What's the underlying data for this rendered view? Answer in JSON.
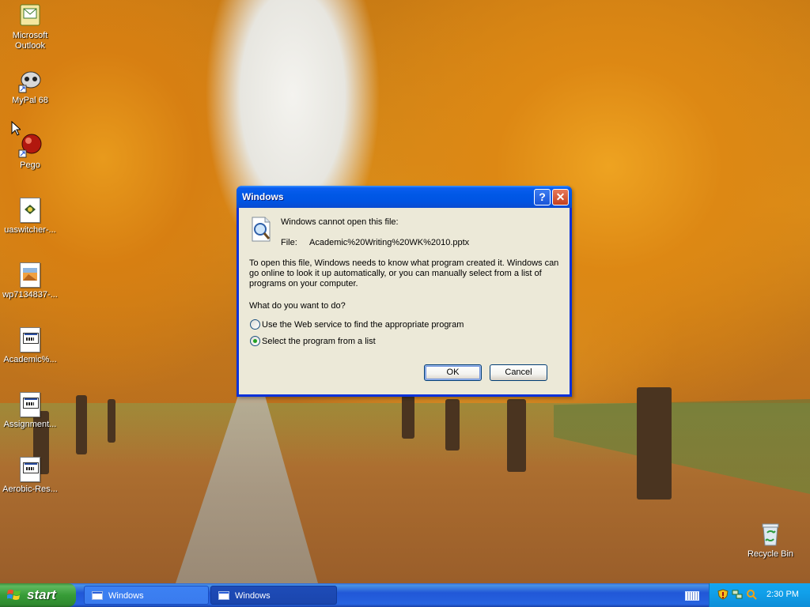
{
  "desktop": {
    "icons": [
      {
        "label": "Microsoft\nOutlook",
        "icon": "outlook-icon"
      },
      {
        "label": "MyPal 68",
        "icon": "mypal-browser-icon"
      },
      {
        "label": "Pego",
        "icon": "pego-icon"
      },
      {
        "label": "uaswitcher-...",
        "icon": "document-icon"
      },
      {
        "label": "wp7134837-...",
        "icon": "image-file-icon"
      },
      {
        "label": "Academic%...",
        "icon": "document-icon"
      },
      {
        "label": "Assignment...",
        "icon": "document-icon"
      },
      {
        "label": "Aerobic-Res...",
        "icon": "document-icon"
      },
      {
        "label": "Recycle Bin",
        "icon": "recycle-bin-icon"
      }
    ]
  },
  "dialog": {
    "title": "Windows",
    "header": "Windows cannot open this file:",
    "file_label": "File:",
    "file_name": "Academic%20Writing%20WK%2010.pptx",
    "description": "To open this file, Windows needs to know what program created it.  Windows can go online to look it up automatically, or you can manually select from a list of programs on your computer.",
    "question": "What do you want to do?",
    "options": [
      {
        "label": "Use the Web service to find the appropriate program",
        "selected": false
      },
      {
        "label": "Select the program from a list",
        "selected": true
      }
    ],
    "ok_label": "OK",
    "cancel_label": "Cancel",
    "help_button": "?",
    "close_button": "✕"
  },
  "taskbar": {
    "start_label": "start",
    "tasks": [
      {
        "label": "Windows",
        "active": true
      },
      {
        "label": "Windows",
        "active": false
      }
    ],
    "clock": "2:30 PM"
  },
  "colors": {
    "title_bar": "#0054e3",
    "dialog_face": "#ece9d8",
    "taskbar": "#245edb",
    "start_button": "#3c9c3c",
    "tray": "#0f9bea"
  }
}
